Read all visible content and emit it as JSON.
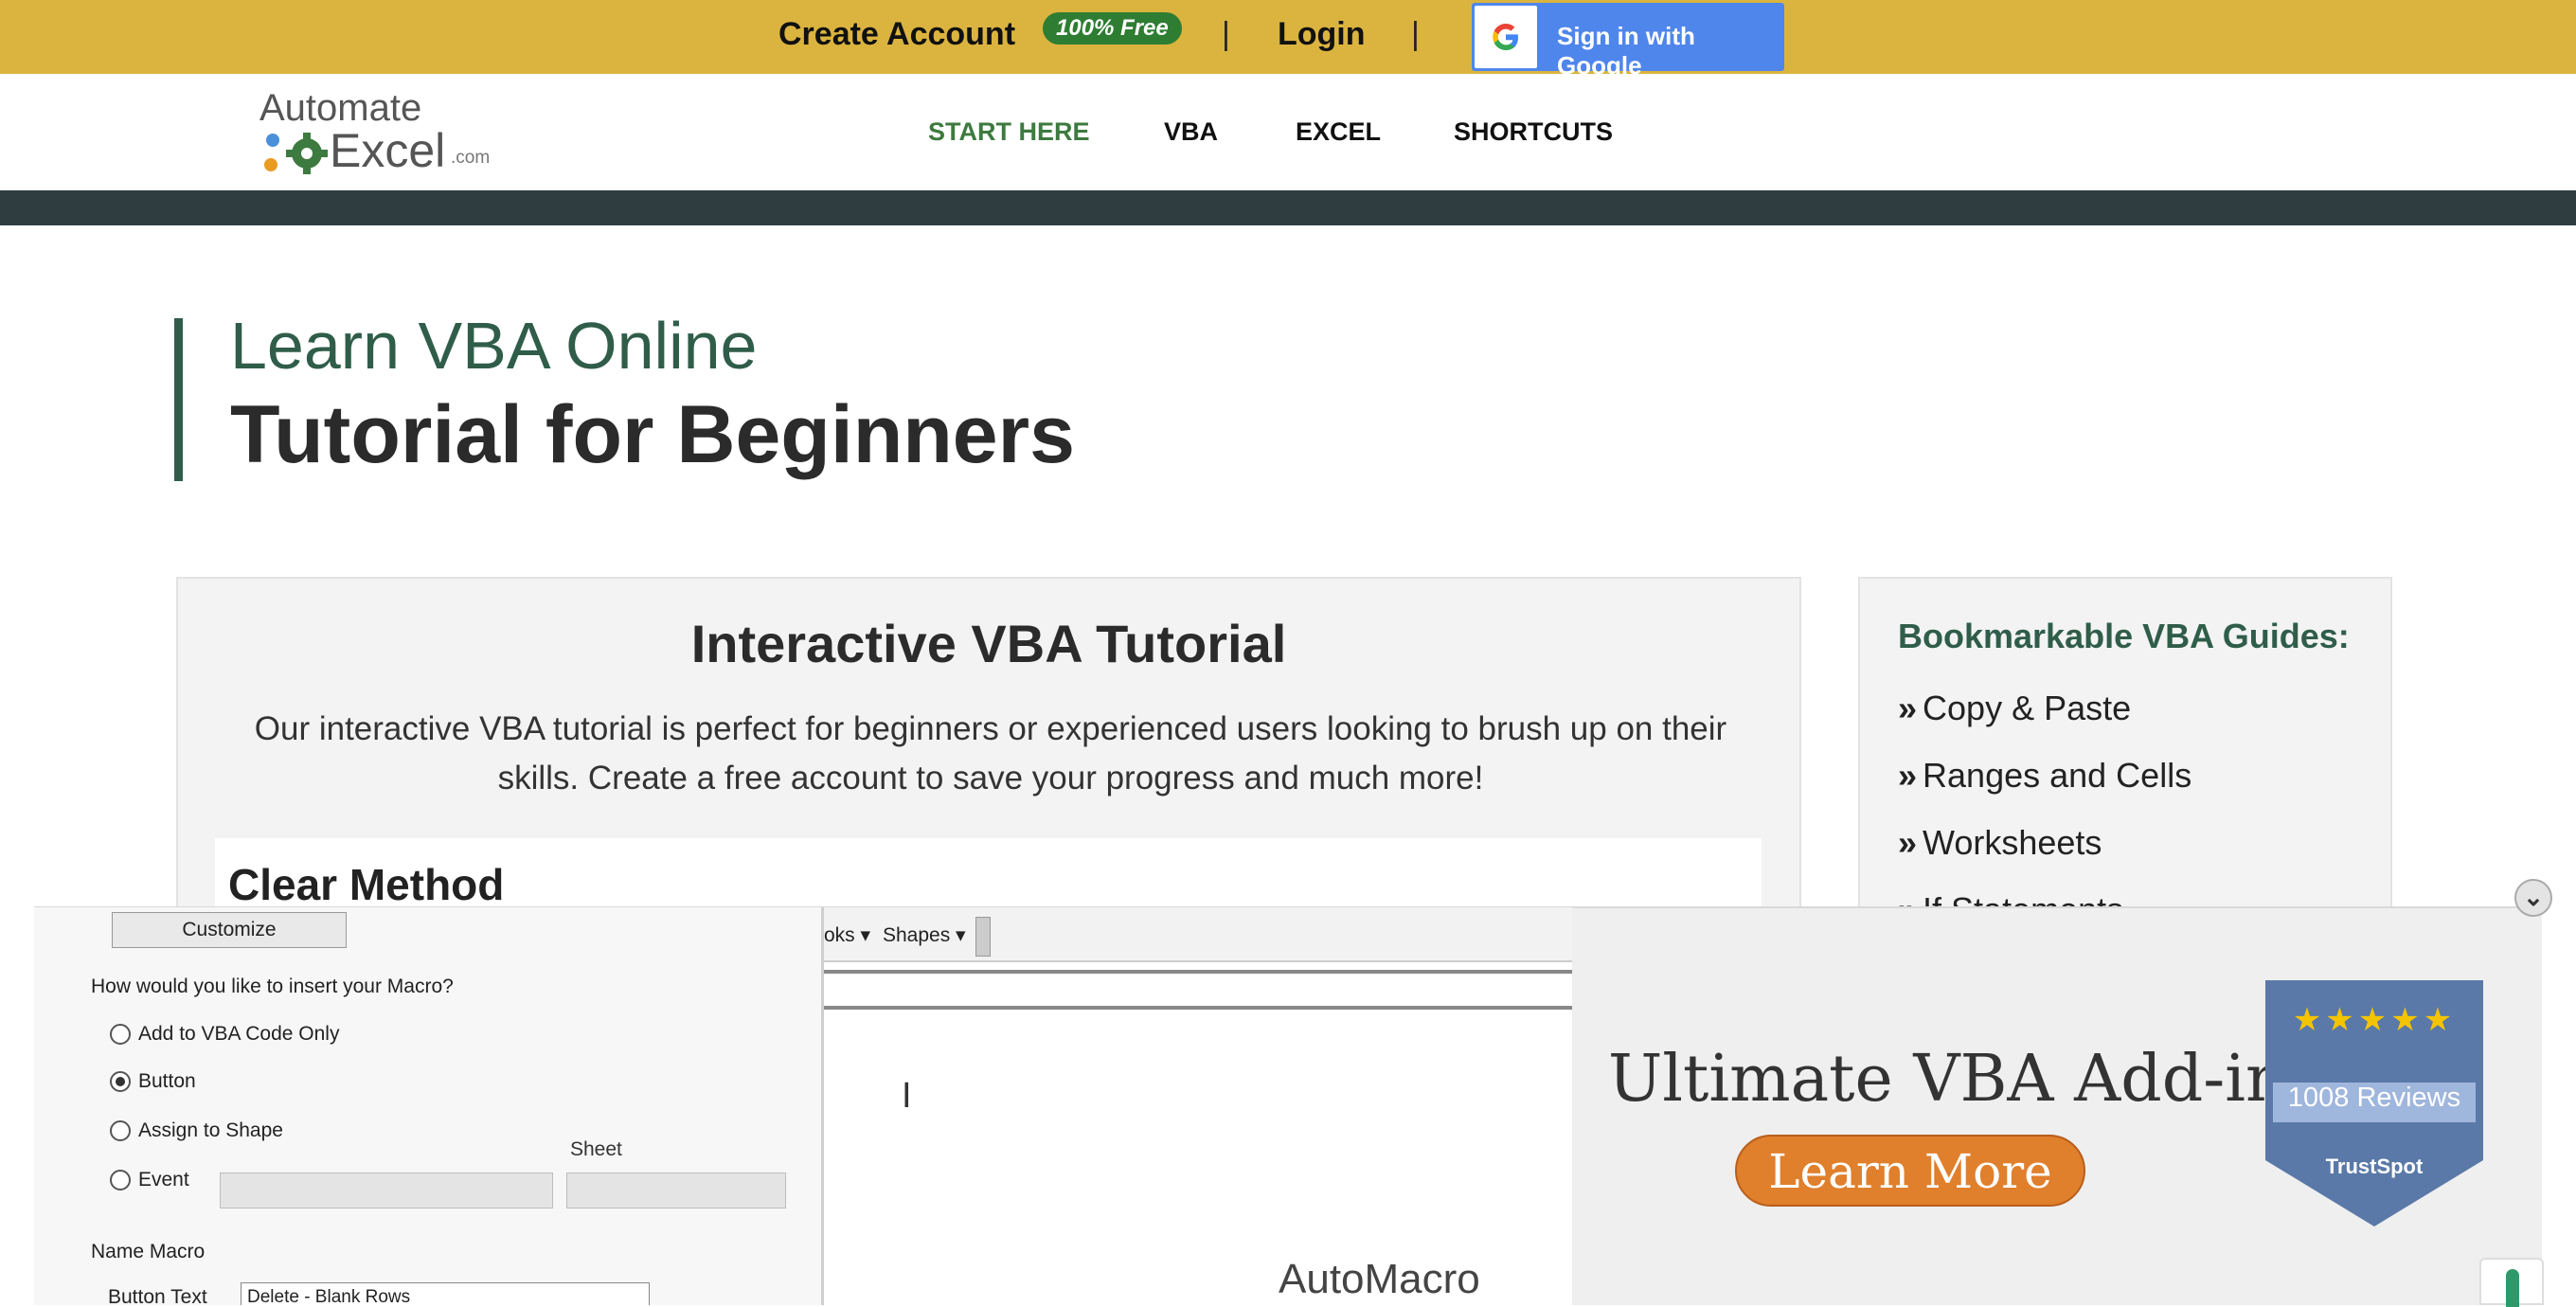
{
  "topbar": {
    "create_account": "Create Account",
    "free_badge": "100% Free",
    "separator": "|",
    "login": "Login",
    "google_button": "Sign in with Google",
    "colors": {
      "bar": "#dbb43f",
      "badge": "#2e7d32",
      "google": "#4f86ec"
    }
  },
  "logo": {
    "line1": "Automate",
    "line2": "Excel",
    "suffix": ".com"
  },
  "nav": {
    "items": [
      {
        "label": "START HERE",
        "active": true
      },
      {
        "label": "VBA",
        "active": false
      },
      {
        "label": "EXCEL",
        "active": false
      },
      {
        "label": "SHORTCUTS",
        "active": false
      }
    ]
  },
  "hero": {
    "subtitle": "Learn VBA Online",
    "title": "Tutorial for Beginners"
  },
  "tutorial_card": {
    "heading": "Interactive VBA Tutorial",
    "body": "Our interactive VBA tutorial is perfect for beginners or experienced users looking to brush up on their skills. Create a free account to save your progress and much more!",
    "preview_title": "Clear Method"
  },
  "sidebar": {
    "heading": "Bookmarkable VBA Guides:",
    "chevron": "»",
    "items": [
      "Copy & Paste",
      "Ranges and Cells",
      "Worksheets",
      "If Statements"
    ]
  },
  "ad": {
    "customize_button": "Customize",
    "question": "How would you like to insert your Macro?",
    "options": [
      {
        "label": "Add to VBA Code Only",
        "selected": false
      },
      {
        "label": "Button",
        "selected": true
      },
      {
        "label": "Assign to Shape",
        "selected": false
      },
      {
        "label": "Event",
        "selected": false
      }
    ],
    "sheet_label": "Sheet",
    "name_macro_label": "Name Macro",
    "button_text_label": "Button Text",
    "button_text_value": "Delete - Blank Rows",
    "ribbon_items": [
      "oks ▾",
      "Shapes ▾"
    ],
    "brand": "AutoMacro",
    "headline": "Ultimate VBA Add-in",
    "cta": "Learn More",
    "reviews": "1008 Reviews",
    "stars": "★★★★★",
    "review_brand": "TrustSpot",
    "collapse_icon": "chevron-double-down-icon"
  }
}
